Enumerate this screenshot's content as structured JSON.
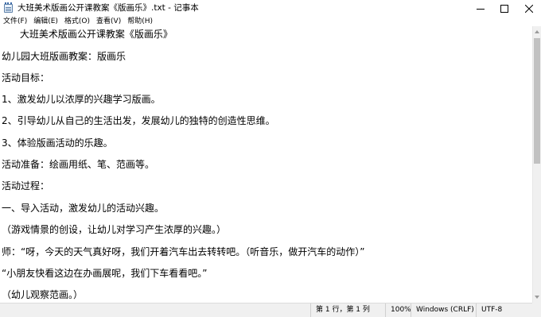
{
  "window": {
    "title": "大班美术版画公开课教案《版画乐》.txt - 记事本",
    "icon": "notepad-icon"
  },
  "menu": {
    "items": [
      "文件(F)",
      "编辑(E)",
      "格式(O)",
      "查看(V)",
      "帮助(H)"
    ]
  },
  "document": {
    "lines": [
      "      大班美术版画公开课教案《版画乐》",
      "幼儿园大班版画教案：版画乐",
      "活动目标：",
      "1、激发幼儿以浓厚的兴趣学习版画。",
      "2、引导幼儿从自己的生活出发，发展幼儿的独特的创造性思维。",
      "3、体验版画活动的乐趣。",
      "活动准备：绘画用纸、笔、范画等。",
      "活动过程：",
      "一、导入活动，激发幼儿的活动兴趣。",
      "（游戏情景的创设，让幼儿对学习产生浓厚的兴趣。）",
      "师：“呀，今天的天气真好呀，我们开着汽车出去转转吧。（听音乐，做开汽车的动作）”",
      "“小朋友快看这边在办画展呢，我们下车看看吧。”",
      "（幼儿观察范画。）"
    ]
  },
  "status": {
    "position": "第 1 行，第 1 列",
    "zoom": "100%",
    "line_ending": "Windows (CRLF)",
    "encoding": "UTF-8"
  }
}
